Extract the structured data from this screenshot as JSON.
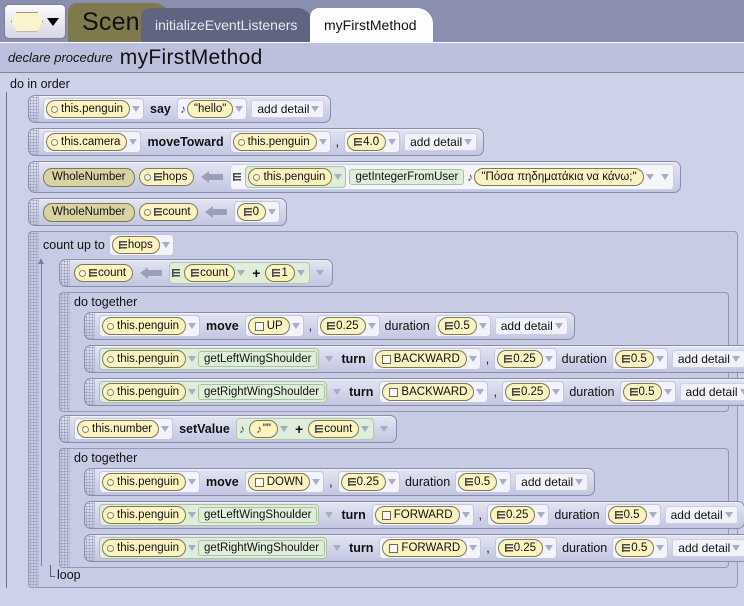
{
  "window": {
    "tabs": [
      {
        "id": "scene",
        "label": "Scene",
        "active": false
      },
      {
        "id": "init",
        "label": "initializeEventListeners",
        "active": false
      },
      {
        "id": "my",
        "label": "myFirstMethod",
        "active": true
      }
    ],
    "class_dropdown_icon": "hexagon-dropdown-icon"
  },
  "header": {
    "declare_label": "declare procedure",
    "method_name": "myFirstMethod"
  },
  "editor": {
    "root_label": "do in order",
    "loop_footer": "loop",
    "add_detail_label": "add detail",
    "statements": {
      "say": {
        "target": "this.penguin",
        "keyword": "say",
        "arg": "\"hello\""
      },
      "moveToward": {
        "target": "this.camera",
        "keyword": "moveToward",
        "arg_target": "this.penguin",
        "comma": ",",
        "amount": "4.0"
      },
      "declare_hops": {
        "type": "WholeNumber",
        "name": "hops",
        "init_target": "this.penguin",
        "init_method": "getIntegerFromUser",
        "init_prompt": "\"Πόσα πηδηματάκια να κάνω;\""
      },
      "declare_count": {
        "type": "WholeNumber",
        "name": "count",
        "value": "0"
      },
      "count_loop": {
        "label": "count up to",
        "bound": "hops"
      },
      "increment": {
        "lhs": "count",
        "rhs_a": "count",
        "operator": "+",
        "rhs_b": "1"
      },
      "do_together_up": {
        "label": "do together",
        "rows": [
          {
            "target": "this.penguin",
            "method": "",
            "keyword": "move",
            "direction": "UP",
            "comma": ",",
            "amount": "0.25",
            "duration_label": "duration",
            "duration": "0.5"
          },
          {
            "target": "this.penguin",
            "method": "getLeftWingShoulder",
            "keyword": "turn",
            "direction": "BACKWARD",
            "comma": ",",
            "amount": "0.25",
            "duration_label": "duration",
            "duration": "0.5"
          },
          {
            "target": "this.penguin",
            "method": "getRightWingShoulder",
            "keyword": "turn",
            "direction": "BACKWARD",
            "comma": ",",
            "amount": "0.25",
            "duration_label": "duration",
            "duration": "0.5"
          }
        ]
      },
      "set_value": {
        "target": "this.number",
        "keyword": "setValue",
        "arg_a": "\"\"",
        "operator": "+",
        "arg_b": "count"
      },
      "do_together_down": {
        "label": "do together",
        "rows": [
          {
            "target": "this.penguin",
            "method": "",
            "keyword": "move",
            "direction": "DOWN",
            "comma": ",",
            "amount": "0.25",
            "duration_label": "duration",
            "duration": "0.5"
          },
          {
            "target": "this.penguin",
            "method": "getLeftWingShoulder",
            "keyword": "turn",
            "direction": "FORWARD",
            "comma": ",",
            "amount": "0.25",
            "duration_label": "duration",
            "duration": "0.5"
          },
          {
            "target": "this.penguin",
            "method": "getRightWingShoulder",
            "keyword": "turn",
            "direction": "FORWARD",
            "comma": ",",
            "amount": "0.25",
            "duration_label": "duration",
            "duration": "0.5"
          }
        ]
      }
    }
  },
  "colors": {
    "window_bg": "#8a8fb0",
    "canvas_bg": "#ced2e8",
    "header_bg": "#bcc0dd",
    "tab_scene_bg": "#7f7a4e",
    "tab_inactive_bg": "#5f6480",
    "tab_active_bg": "#fdfdff",
    "chip_yellow": "#fcf4c0",
    "chip_green": "#dfeeda",
    "type_chip": "#d9d3a2"
  }
}
